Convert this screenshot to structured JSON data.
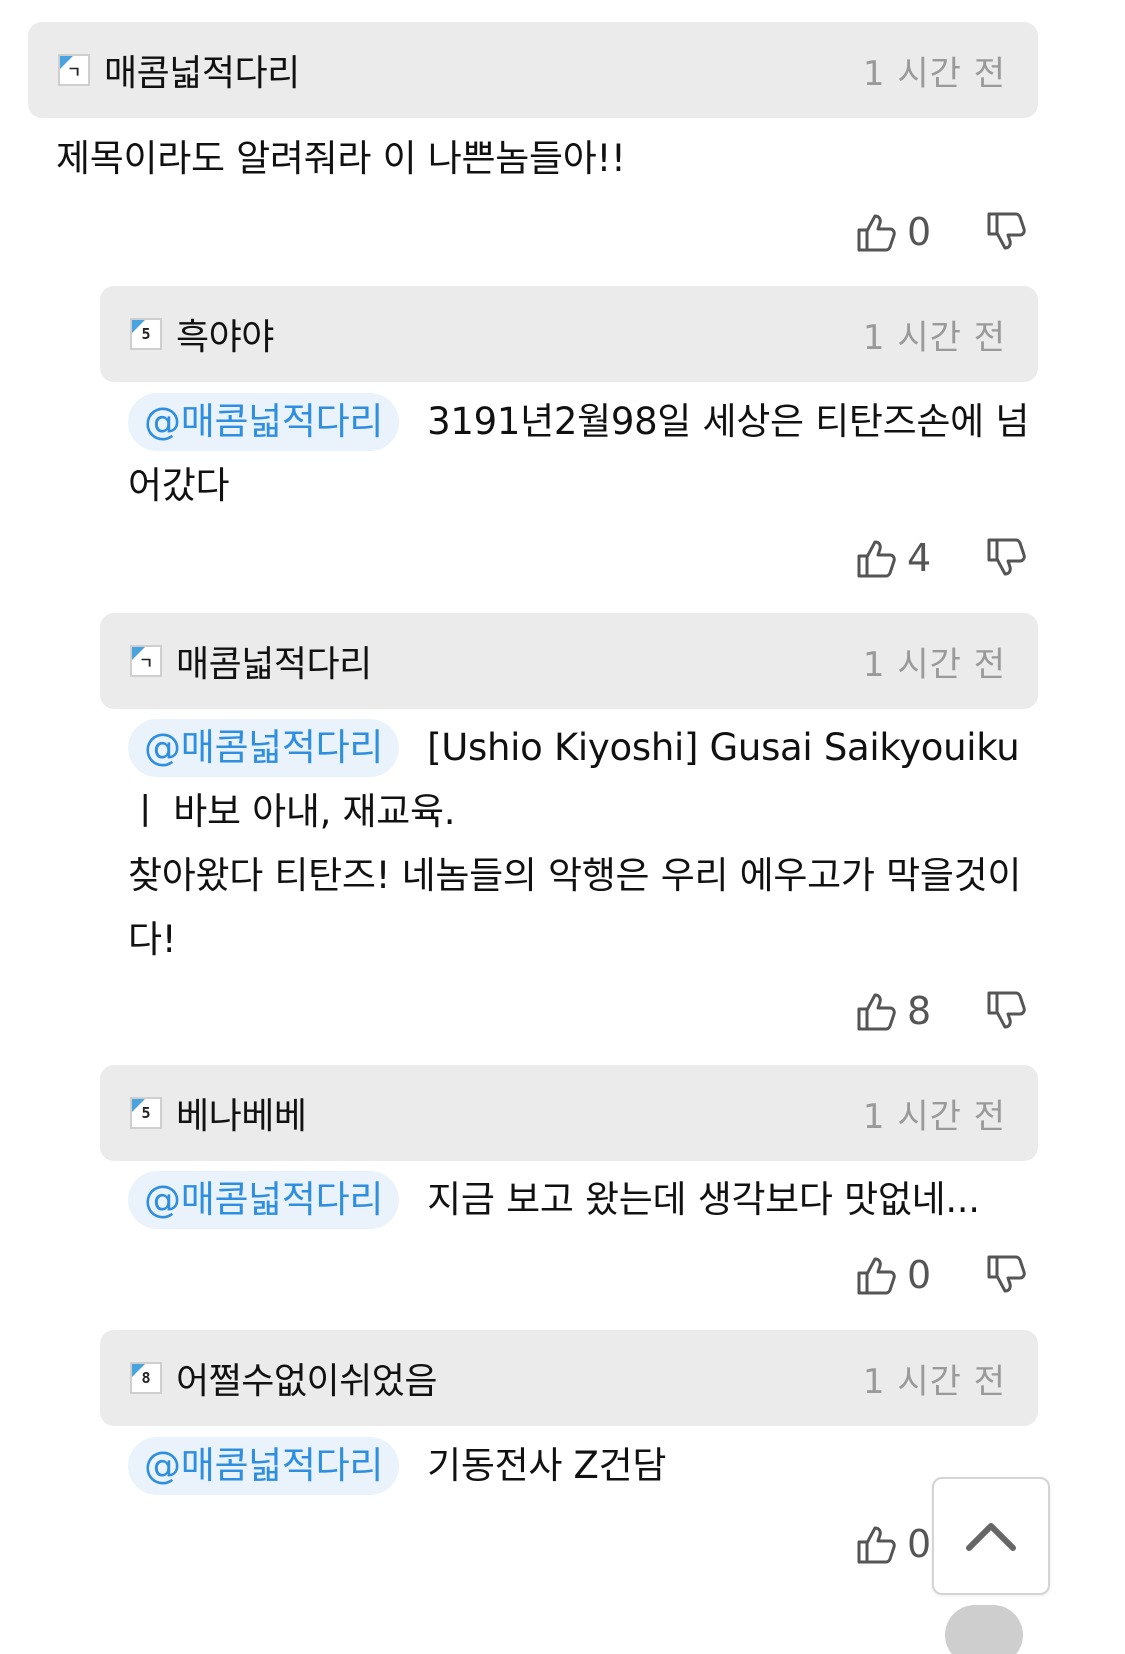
{
  "comments": [
    {
      "nickname": "매콤넓적다리",
      "level": "ㄱ",
      "time": "1 시간 전",
      "mention": "",
      "text": "제목이라도 알려줘라 이 나쁜놈들아!!",
      "likes": "0"
    },
    {
      "nickname": "흑야야",
      "level": "5",
      "time": "1 시간 전",
      "mention": "@매콤넓적다리",
      "text": "3191년2월98일 세상은 티탄즈손에 넘어갔다",
      "likes": "4"
    },
    {
      "nickname": "매콤넓적다리",
      "level": "ㄱ",
      "time": "1 시간 전",
      "mention": "@매콤넓적다리",
      "text": "[Ushio Kiyoshi] Gusai Saikyouiku ㅣ 바보 아내, 재교육.",
      "text2": "찾아왔다 티탄즈! 네놈들의 악행은 우리 에우고가 막을것이다!",
      "likes": "8"
    },
    {
      "nickname": "베나베베",
      "level": "5",
      "time": "1 시간 전",
      "mention": "@매콤넓적다리",
      "text": "지금 보고 왔는데 생각보다 맛없네...",
      "likes": "0"
    },
    {
      "nickname": "어쩔수없이쉬었음",
      "level": "8",
      "time": "1 시간 전",
      "mention": "@매콤넓적다리",
      "text": "기동전사 Z건담",
      "likes": "0"
    }
  ],
  "icons": {
    "like": "thumbs-up-icon",
    "dislike": "thumbs-down-icon",
    "scroll_top": "chevron-up-icon"
  },
  "colors": {
    "mention_text": "#2e8ee0",
    "mention_bg": "#eaf3fb",
    "header_bg": "#ebebeb",
    "time_text": "#9a9a9a"
  }
}
